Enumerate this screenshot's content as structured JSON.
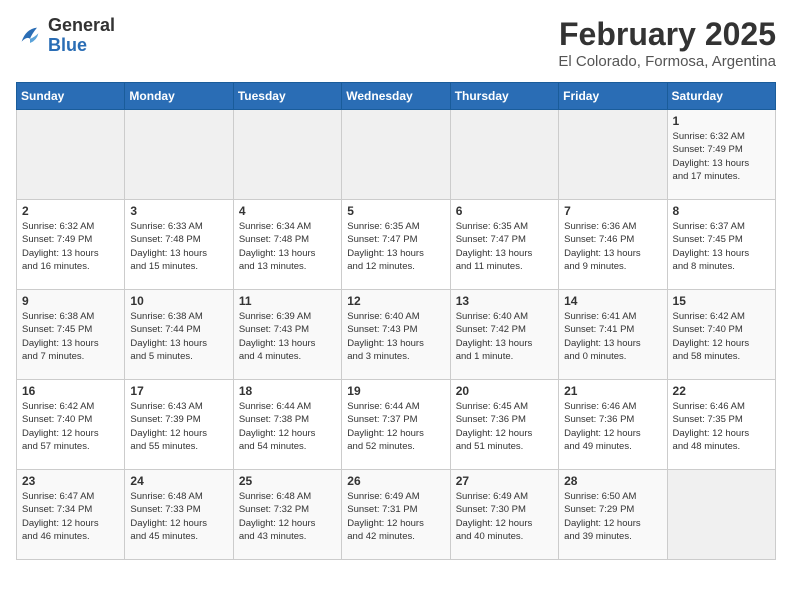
{
  "header": {
    "logo_general": "General",
    "logo_blue": "Blue",
    "title": "February 2025",
    "subtitle": "El Colorado, Formosa, Argentina"
  },
  "days_of_week": [
    "Sunday",
    "Monday",
    "Tuesday",
    "Wednesday",
    "Thursday",
    "Friday",
    "Saturday"
  ],
  "weeks": [
    [
      {
        "day": "",
        "info": ""
      },
      {
        "day": "",
        "info": ""
      },
      {
        "day": "",
        "info": ""
      },
      {
        "day": "",
        "info": ""
      },
      {
        "day": "",
        "info": ""
      },
      {
        "day": "",
        "info": ""
      },
      {
        "day": "1",
        "info": "Sunrise: 6:32 AM\nSunset: 7:49 PM\nDaylight: 13 hours\nand 17 minutes."
      }
    ],
    [
      {
        "day": "2",
        "info": "Sunrise: 6:32 AM\nSunset: 7:49 PM\nDaylight: 13 hours\nand 16 minutes."
      },
      {
        "day": "3",
        "info": "Sunrise: 6:33 AM\nSunset: 7:48 PM\nDaylight: 13 hours\nand 15 minutes."
      },
      {
        "day": "4",
        "info": "Sunrise: 6:34 AM\nSunset: 7:48 PM\nDaylight: 13 hours\nand 13 minutes."
      },
      {
        "day": "5",
        "info": "Sunrise: 6:35 AM\nSunset: 7:47 PM\nDaylight: 13 hours\nand 12 minutes."
      },
      {
        "day": "6",
        "info": "Sunrise: 6:35 AM\nSunset: 7:47 PM\nDaylight: 13 hours\nand 11 minutes."
      },
      {
        "day": "7",
        "info": "Sunrise: 6:36 AM\nSunset: 7:46 PM\nDaylight: 13 hours\nand 9 minutes."
      },
      {
        "day": "8",
        "info": "Sunrise: 6:37 AM\nSunset: 7:45 PM\nDaylight: 13 hours\nand 8 minutes."
      }
    ],
    [
      {
        "day": "9",
        "info": "Sunrise: 6:38 AM\nSunset: 7:45 PM\nDaylight: 13 hours\nand 7 minutes."
      },
      {
        "day": "10",
        "info": "Sunrise: 6:38 AM\nSunset: 7:44 PM\nDaylight: 13 hours\nand 5 minutes."
      },
      {
        "day": "11",
        "info": "Sunrise: 6:39 AM\nSunset: 7:43 PM\nDaylight: 13 hours\nand 4 minutes."
      },
      {
        "day": "12",
        "info": "Sunrise: 6:40 AM\nSunset: 7:43 PM\nDaylight: 13 hours\nand 3 minutes."
      },
      {
        "day": "13",
        "info": "Sunrise: 6:40 AM\nSunset: 7:42 PM\nDaylight: 13 hours\nand 1 minute."
      },
      {
        "day": "14",
        "info": "Sunrise: 6:41 AM\nSunset: 7:41 PM\nDaylight: 13 hours\nand 0 minutes."
      },
      {
        "day": "15",
        "info": "Sunrise: 6:42 AM\nSunset: 7:40 PM\nDaylight: 12 hours\nand 58 minutes."
      }
    ],
    [
      {
        "day": "16",
        "info": "Sunrise: 6:42 AM\nSunset: 7:40 PM\nDaylight: 12 hours\nand 57 minutes."
      },
      {
        "day": "17",
        "info": "Sunrise: 6:43 AM\nSunset: 7:39 PM\nDaylight: 12 hours\nand 55 minutes."
      },
      {
        "day": "18",
        "info": "Sunrise: 6:44 AM\nSunset: 7:38 PM\nDaylight: 12 hours\nand 54 minutes."
      },
      {
        "day": "19",
        "info": "Sunrise: 6:44 AM\nSunset: 7:37 PM\nDaylight: 12 hours\nand 52 minutes."
      },
      {
        "day": "20",
        "info": "Sunrise: 6:45 AM\nSunset: 7:36 PM\nDaylight: 12 hours\nand 51 minutes."
      },
      {
        "day": "21",
        "info": "Sunrise: 6:46 AM\nSunset: 7:36 PM\nDaylight: 12 hours\nand 49 minutes."
      },
      {
        "day": "22",
        "info": "Sunrise: 6:46 AM\nSunset: 7:35 PM\nDaylight: 12 hours\nand 48 minutes."
      }
    ],
    [
      {
        "day": "23",
        "info": "Sunrise: 6:47 AM\nSunset: 7:34 PM\nDaylight: 12 hours\nand 46 minutes."
      },
      {
        "day": "24",
        "info": "Sunrise: 6:48 AM\nSunset: 7:33 PM\nDaylight: 12 hours\nand 45 minutes."
      },
      {
        "day": "25",
        "info": "Sunrise: 6:48 AM\nSunset: 7:32 PM\nDaylight: 12 hours\nand 43 minutes."
      },
      {
        "day": "26",
        "info": "Sunrise: 6:49 AM\nSunset: 7:31 PM\nDaylight: 12 hours\nand 42 minutes."
      },
      {
        "day": "27",
        "info": "Sunrise: 6:49 AM\nSunset: 7:30 PM\nDaylight: 12 hours\nand 40 minutes."
      },
      {
        "day": "28",
        "info": "Sunrise: 6:50 AM\nSunset: 7:29 PM\nDaylight: 12 hours\nand 39 minutes."
      },
      {
        "day": "",
        "info": ""
      }
    ]
  ]
}
